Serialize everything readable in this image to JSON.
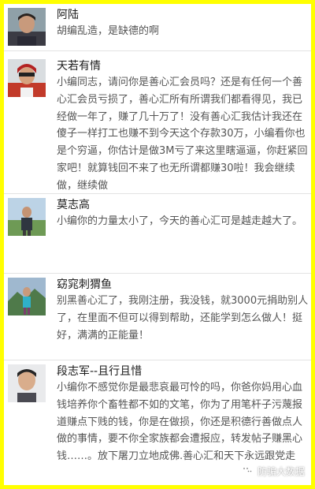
{
  "comments": [
    {
      "name": "阿陆",
      "text": "胡编乱造，是缺德的啊",
      "avatar_icon": "user-avatar-man-dark-shirt"
    },
    {
      "name": "天若有情",
      "text": "小编同志，请问你是善心汇会员吗？还是有任何一个善心汇会员亏损了，善心汇所有所谓我们都看得见，我已经做一年了，赚了几十万了！没有善心汇我估计我还在傻子一样打工也赚不到今天这个存款30万，小编看你也是个穷逼，你估计是做3M亏了来这里瞎逼逼，你赶紧回家吧！就算钱回不来了也无所谓都赚30啦！我会继续做，继续做",
      "avatar_icon": "user-avatar-racing-driver"
    },
    {
      "name": "莫志高",
      "text": "小编你的力量太小了，今天的善心汇可是越走越大了。",
      "avatar_icon": "user-avatar-man-outdoors"
    },
    {
      "name": "窈窕刺猬鱼",
      "text": "别黑善心汇了，我刚注册，我没钱，就3000元捐助别人了，在里面不但可以得到帮助，还能学到怎么做人！挺好，满满的正能量！",
      "avatar_icon": "user-avatar-person-landscape"
    },
    {
      "name": "段志军--且行且惜",
      "text": "小编你不感觉你是最悲哀最可怜的吗，你爸你妈用心血钱培养你个畜牲都不如的文笔，你为了用笔杆子污蔑报道赚点下贱的钱，你是在做损，你还是积德行善做点人做的事情，要不你全家族都会遭报应，转发帖子赚黑心钱……。放下屠刀立地成佛.善心汇和天下永远跟党走",
      "avatar_icon": "user-avatar-young-man"
    }
  ],
  "watermark": {
    "label": "防骗大数据",
    "icon": "wechat-bubble-icon"
  },
  "colors": {
    "frame": "#ffff00",
    "name": "#1a1a1a",
    "text": "#555555",
    "divider": "#e3e3e3"
  }
}
